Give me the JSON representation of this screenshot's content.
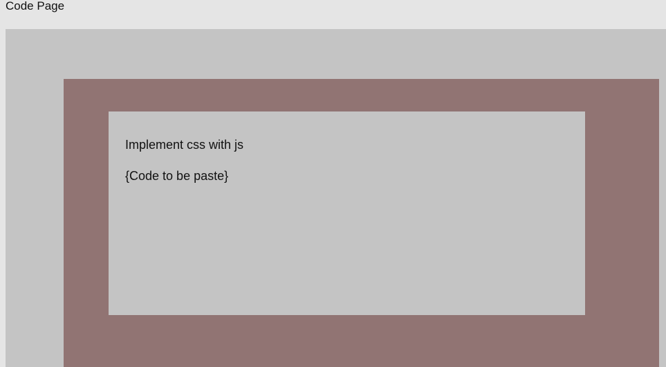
{
  "header": {
    "title": "Code Page"
  },
  "card": {
    "heading": "Implement css with js",
    "code_placeholder": "{Code to be paste}"
  },
  "colors": {
    "page_background": "#e5e5e5",
    "outer_panel": "#c4c4c4",
    "frame_panel": "#917473",
    "card_background": "#c4c4c4",
    "text": "#111111"
  }
}
